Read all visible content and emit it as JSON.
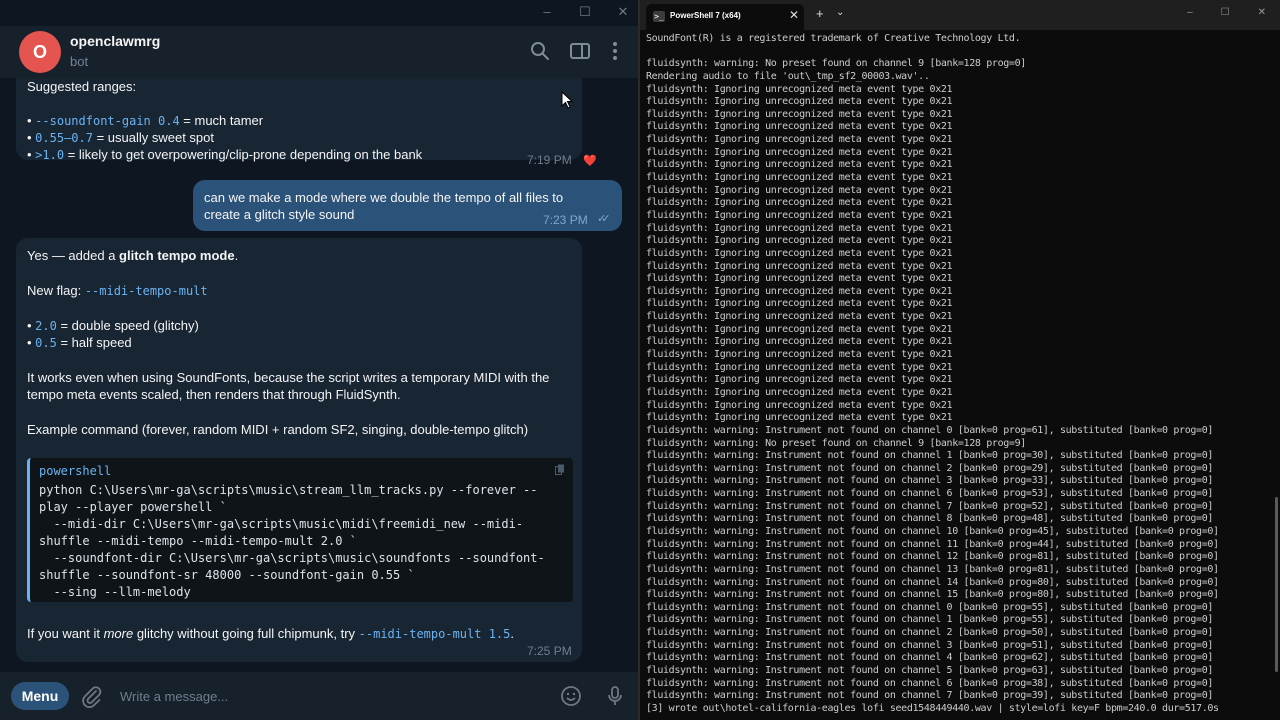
{
  "telegram": {
    "avatar_letter": "O",
    "chat_name": "openclawmrg",
    "chat_sub": "bot",
    "window_caps": [
      "–",
      "☐",
      "✕"
    ],
    "msg1": {
      "heading": "Suggested ranges:",
      "items": [
        {
          "code": "--soundfont-gain 0.4",
          "text": " = much tamer"
        },
        {
          "code": "0.55–0.7",
          "text": " = usually sweet spot"
        },
        {
          "code": ">1.0",
          "text": " = likely to get overpowering/clip-prone depending on the bank"
        }
      ],
      "time": "7:19 PM",
      "reaction": "❤️"
    },
    "msg2": {
      "line1": "can we make a mode where we double the tempo of all files to",
      "line2": "create a glitch style sound",
      "time": "7:23 PM",
      "checks": "✓✓"
    },
    "msg3": {
      "intro_pre": "Yes — added a ",
      "intro_bold": "glitch tempo mode",
      "intro_post": ".",
      "flag_label": "New flag: ",
      "flag_code": "--midi-tempo-mult",
      "items": [
        {
          "code": "2.0",
          "text": " = double speed (glitchy)"
        },
        {
          "code": "0.5",
          "text": " = half speed"
        }
      ],
      "para1": "It works even when using SoundFonts, because the script writes a temporary MIDI with the",
      "para2": "tempo meta events scaled, then renders that through FluidSynth.",
      "example": "Example command (forever, random MIDI + random SF2, singing, double-tempo glitch)",
      "code_lang": "powershell",
      "code_lines": [
        "python C:\\Users\\mr-ga\\scripts\\music\\stream_llm_tracks.py --forever --",
        "play --player powershell `",
        "  --midi-dir C:\\Users\\mr-ga\\scripts\\music\\midi\\freemidi_new --midi-",
        "shuffle --midi-tempo --midi-tempo-mult 2.0 `",
        "  --soundfont-dir C:\\Users\\mr-ga\\scripts\\music\\soundfonts --soundfont-",
        "shuffle --soundfont-sr 48000 --soundfont-gain 0.55 `",
        "  --sing --llm-melody"
      ],
      "tail_pre": "If you want it ",
      "tail_em": "more",
      "tail_mid": " glitchy without going full chipmunk, try ",
      "tail_code": "--midi-tempo-mult 1.5",
      "tail_post": ".",
      "time": "7:25 PM"
    },
    "composer": {
      "menu_label": "Menu",
      "placeholder": "Write a message..."
    },
    "colors": {
      "accent": "#6ab3f3",
      "bubble_out": "#2b5278",
      "bubble_in": "#182533",
      "avatar": "#e4554f"
    }
  },
  "powershell": {
    "tab_title": "PowerShell 7 (x64)",
    "tab_icon": ">_",
    "close": "✕",
    "new_tab": "+",
    "dropdown": "⌄",
    "window_caps": [
      "–",
      "☐",
      "✕"
    ],
    "lines": [
      "SoundFont(R) is a registered trademark of Creative Technology Ltd.",
      "",
      "fluidsynth: warning: No preset found on channel 9 [bank=128 prog=0]",
      "Rendering audio to file 'out\\_tmp_sf2_00003.wav'..",
      "fluidsynth: Ignoring unrecognized meta event type 0x21",
      "fluidsynth: Ignoring unrecognized meta event type 0x21",
      "fluidsynth: Ignoring unrecognized meta event type 0x21",
      "fluidsynth: Ignoring unrecognized meta event type 0x21",
      "fluidsynth: Ignoring unrecognized meta event type 0x21",
      "fluidsynth: Ignoring unrecognized meta event type 0x21",
      "fluidsynth: Ignoring unrecognized meta event type 0x21",
      "fluidsynth: Ignoring unrecognized meta event type 0x21",
      "fluidsynth: Ignoring unrecognized meta event type 0x21",
      "fluidsynth: Ignoring unrecognized meta event type 0x21",
      "fluidsynth: Ignoring unrecognized meta event type 0x21",
      "fluidsynth: Ignoring unrecognized meta event type 0x21",
      "fluidsynth: Ignoring unrecognized meta event type 0x21",
      "fluidsynth: Ignoring unrecognized meta event type 0x21",
      "fluidsynth: Ignoring unrecognized meta event type 0x21",
      "fluidsynth: Ignoring unrecognized meta event type 0x21",
      "fluidsynth: Ignoring unrecognized meta event type 0x21",
      "fluidsynth: Ignoring unrecognized meta event type 0x21",
      "fluidsynth: Ignoring unrecognized meta event type 0x21",
      "fluidsynth: Ignoring unrecognized meta event type 0x21",
      "fluidsynth: Ignoring unrecognized meta event type 0x21",
      "fluidsynth: Ignoring unrecognized meta event type 0x21",
      "fluidsynth: Ignoring unrecognized meta event type 0x21",
      "fluidsynth: Ignoring unrecognized meta event type 0x21",
      "fluidsynth: Ignoring unrecognized meta event type 0x21",
      "fluidsynth: Ignoring unrecognized meta event type 0x21",
      "fluidsynth: Ignoring unrecognized meta event type 0x21",
      "fluidsynth: warning: Instrument not found on channel 0 [bank=0 prog=61], substituted [bank=0 prog=0]",
      "fluidsynth: warning: No preset found on channel 9 [bank=128 prog=9]",
      "fluidsynth: warning: Instrument not found on channel 1 [bank=0 prog=30], substituted [bank=0 prog=0]",
      "fluidsynth: warning: Instrument not found on channel 2 [bank=0 prog=29], substituted [bank=0 prog=0]",
      "fluidsynth: warning: Instrument not found on channel 3 [bank=0 prog=33], substituted [bank=0 prog=0]",
      "fluidsynth: warning: Instrument not found on channel 6 [bank=0 prog=53], substituted [bank=0 prog=0]",
      "fluidsynth: warning: Instrument not found on channel 7 [bank=0 prog=52], substituted [bank=0 prog=0]",
      "fluidsynth: warning: Instrument not found on channel 8 [bank=0 prog=48], substituted [bank=0 prog=0]",
      "fluidsynth: warning: Instrument not found on channel 10 [bank=0 prog=45], substituted [bank=0 prog=0]",
      "fluidsynth: warning: Instrument not found on channel 11 [bank=0 prog=44], substituted [bank=0 prog=0]",
      "fluidsynth: warning: Instrument not found on channel 12 [bank=0 prog=81], substituted [bank=0 prog=0]",
      "fluidsynth: warning: Instrument not found on channel 13 [bank=0 prog=81], substituted [bank=0 prog=0]",
      "fluidsynth: warning: Instrument not found on channel 14 [bank=0 prog=80], substituted [bank=0 prog=0]",
      "fluidsynth: warning: Instrument not found on channel 15 [bank=0 prog=80], substituted [bank=0 prog=0]",
      "fluidsynth: warning: Instrument not found on channel 0 [bank=0 prog=55], substituted [bank=0 prog=0]",
      "fluidsynth: warning: Instrument not found on channel 1 [bank=0 prog=55], substituted [bank=0 prog=0]",
      "fluidsynth: warning: Instrument not found on channel 2 [bank=0 prog=50], substituted [bank=0 prog=0]",
      "fluidsynth: warning: Instrument not found on channel 3 [bank=0 prog=51], substituted [bank=0 prog=0]",
      "fluidsynth: warning: Instrument not found on channel 4 [bank=0 prog=62], substituted [bank=0 prog=0]",
      "fluidsynth: warning: Instrument not found on channel 5 [bank=0 prog=63], substituted [bank=0 prog=0]",
      "fluidsynth: warning: Instrument not found on channel 6 [bank=0 prog=38], substituted [bank=0 prog=0]",
      "fluidsynth: warning: Instrument not found on channel 7 [bank=0 prog=39], substituted [bank=0 prog=0]",
      "[3] wrote out\\hotel-california-eagles_lofi_seed1548449440.wav | style=lofi key=F bpm=240.0 dur=517.0s"
    ]
  }
}
